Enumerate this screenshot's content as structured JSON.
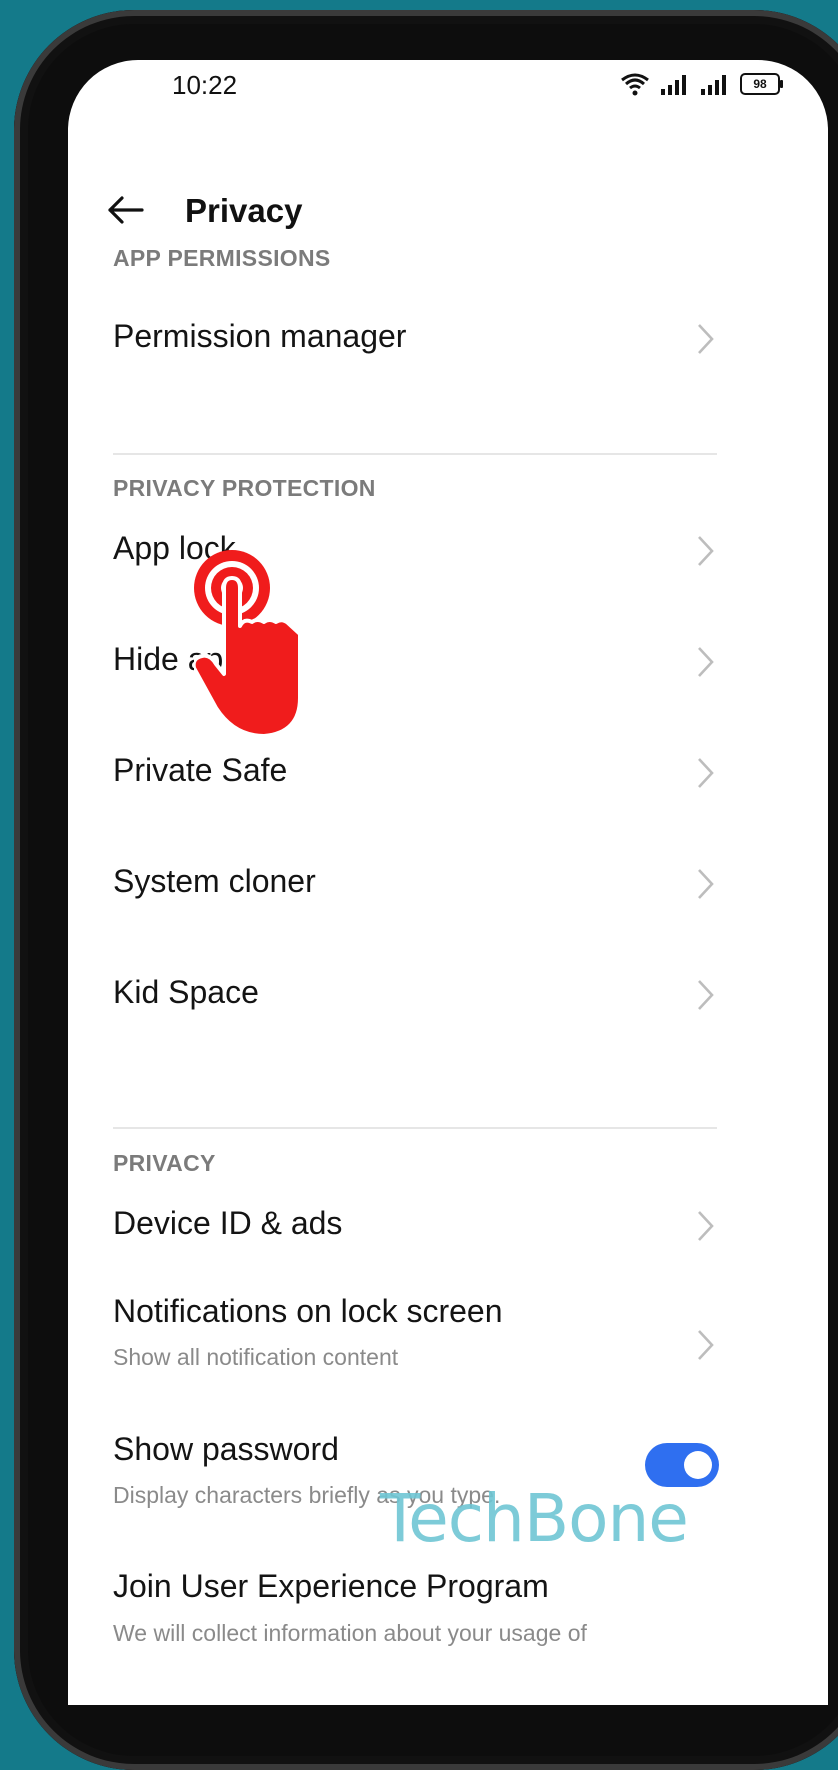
{
  "status_bar": {
    "time": "10:22",
    "battery": "98",
    "icons": [
      "wifi-icon",
      "signal-icon",
      "signal-icon",
      "battery-icon"
    ]
  },
  "header": {
    "title": "Privacy",
    "back_icon": "arrow-left-icon"
  },
  "sections": {
    "app_permissions": {
      "title": "APP PERMISSIONS",
      "items": [
        {
          "label": "Permission manager"
        }
      ]
    },
    "privacy_protection": {
      "title": "PRIVACY PROTECTION",
      "items": [
        {
          "label": "App lock"
        },
        {
          "label": "Hide apps"
        },
        {
          "label": "Private Safe"
        },
        {
          "label": "System cloner"
        },
        {
          "label": "Kid Space"
        }
      ]
    },
    "privacy": {
      "title": "PRIVACY",
      "items": [
        {
          "label": "Device ID & ads"
        },
        {
          "label": "Notifications on lock screen",
          "subtitle": "Show all notification content"
        },
        {
          "label": "Show password",
          "subtitle": "Display characters briefly as you type.",
          "toggle": true
        },
        {
          "label": "Join User Experience Program",
          "subtitle": "We will collect information about your usage of"
        }
      ]
    }
  },
  "overlay": {
    "tap_icon": "hand-pointer-tap-icon",
    "tap_color": "#f01c1c"
  },
  "watermark": "TechBone",
  "colors": {
    "accent": "#2f6ff0",
    "background": "#147a8a",
    "watermark": "#6fc6d4"
  }
}
